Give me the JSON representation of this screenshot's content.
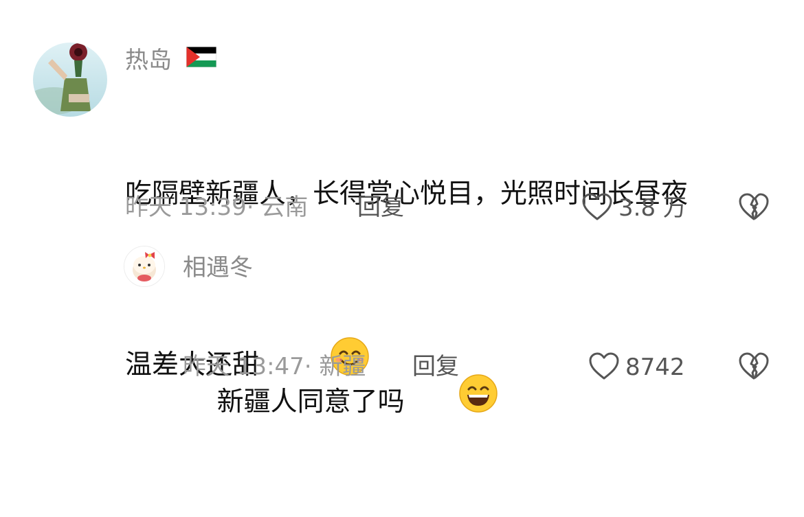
{
  "comments": [
    {
      "username": "热岛",
      "flag_icon": "palestine-flag-icon",
      "text_line1": "吃隔壁新疆人，长得赏心悦目，光照时间长昼夜",
      "text_line2": "温差大还甜",
      "emoji_icon": "smiling-face-icon",
      "time_location": "昨天 13:39· 云南",
      "reply_label": "回复",
      "like_count": "3.8 万",
      "like_icon": "heart-outline-icon",
      "dislike_icon": "broken-heart-icon"
    },
    {
      "username": "相遇冬",
      "text": "新疆人同意了吗",
      "emoji_icon": "grinning-face-icon",
      "time_location": "昨天 13:47· 新疆",
      "reply_label": "回复",
      "like_count": "8742",
      "like_icon": "heart-outline-icon",
      "dislike_icon": "broken-heart-icon"
    }
  ],
  "colors": {
    "username": "#8a8a8a",
    "body_text": "#111111",
    "meta": "#9a9a9a",
    "action": "#555555",
    "emoji_fill": "#ffcc33"
  }
}
